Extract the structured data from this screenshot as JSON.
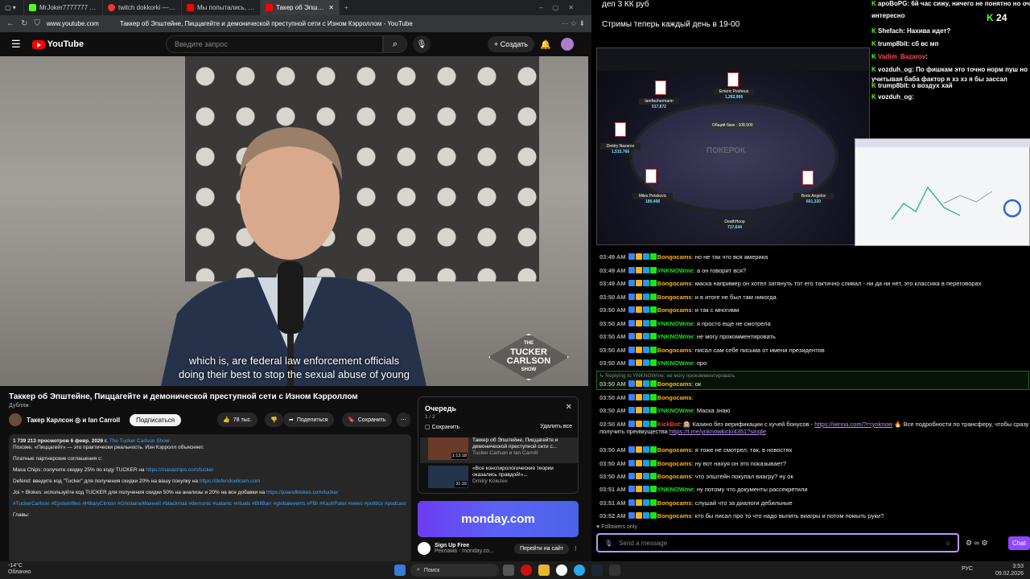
{
  "browser": {
    "tabs": [
      {
        "title": "MrJoker7777777 Clips - W",
        "color": "#53fc18"
      },
      {
        "title": "twitch dokkorki — Яндекс",
        "color": "#ff3333"
      },
      {
        "title": "Мы попытались, но что-т",
        "color": "#ff0000"
      },
      {
        "title": "Такер об Эпштейне",
        "color": "#ff0000"
      }
    ],
    "url": "www.youtube.com",
    "page_title": "Таккер об Эпштейне, Пиццагейте и демонической преступной сети с Изном Кэрроллом - YouTube"
  },
  "youtube": {
    "logo": "YouTube",
    "search_placeholder": "Введите запрос",
    "create": "+ Создать",
    "subtitle_line1": "which is, are federal law enforcement officials",
    "subtitle_line2": "doing their best to stop the sexual abuse of young",
    "badge": [
      "THE",
      "TUCKER",
      "CARLSON",
      "SHOW"
    ],
    "video_title": "Таккер об Эпштейне, Пиццагейте и демонической преступной сети с Изном Кэрроллом",
    "dub": "Дубляж",
    "channel": "Такер Карлсон ◎ и Ian Carroll",
    "subscribe": "Подписаться",
    "likes": "78 тыс.",
    "share": "Поделиться",
    "save": "Сохранить",
    "desc": {
      "meta": "1 739 213 просмотров  6 февр. 2026 г.",
      "meta_link": "The Tucker Carlson Show",
      "line1": "Похоже, «Пиццагейт» — это практически реальность. Иэн Кэрролл объясняет.",
      "partners": "Платные партнерские соглашения с:",
      "masa": "Masa Chips: получите скидку 25% по коду TUCKER на",
      "masa_link": "https://masachips.com/tucker",
      "defend": "Defend: введите код \"Tucker\" для получения скидки 20% на вашу покупку на",
      "defend_link": "https://defendcellcam.com",
      "joi": "Joi + Blokes: используйте код TUCKER для получения скидки 50% на анализы и 20% на все добавки на",
      "joi_link": "https://joiandblokes.com/tucker",
      "tags": "#TuckerCarlson #Epsteinfiles #HillaryClinton #GhislaineMaxwell #blackmail #demonic #satanic #rituals #BillBarr #globalevents #FBI #KashPatel #news #politics #podcast",
      "chapters": "Главы:"
    },
    "queue": {
      "title": "Очередь",
      "count": "1 / 2",
      "save": "Сохранить",
      "delete_all": "Удалить все",
      "items": [
        {
          "title": "Таккер об Эпштейне, Пиццагейте и демонической преступной сети с...",
          "channel": "Tucker Carlson и Ian Carroll",
          "duration": "1:13:18"
        },
        {
          "title": "«Все конспирологические теории оказались правдой!»...",
          "channel": "Dmitry Kolezev",
          "duration": "31:16"
        }
      ]
    },
    "ad": {
      "brand": "monday.com",
      "title": "Sign Up Free",
      "sub": "Реклама · monday.co...",
      "cta": "Перейти на сайт"
    }
  },
  "stream": {
    "title1": "деп 3 КК руб",
    "title2": "Стримы теперь каждый день в 19-00",
    "counter": "24",
    "poker": {
      "logo": "ПОКЕРОК",
      "pot": "Общий банк : 108,500",
      "seats": [
        {
          "name": "Iamfischermann",
          "stack": "517,872"
        },
        {
          "name": "Emeric Pesheus",
          "stack": "1,282,906"
        },
        {
          "name": "Dmitry Nazarov",
          "stack": "1,515,766"
        },
        {
          "name": "Miles Petskovic",
          "stack": "189,408"
        },
        {
          "name": "Boris Angelov",
          "stack": "601,330"
        },
        {
          "name": "DeathHoop",
          "stack": "717,644"
        }
      ]
    }
  },
  "topchat": [
    {
      "user": "apoBoPG",
      "text": ": 6й час сижу, ничего не понятно но очень",
      "color": "#ffffff"
    },
    {
      "user": "",
      "text": "интересно",
      "color": "#ffffff"
    },
    {
      "user": "Shefach",
      "text": ": Нахива идет?",
      "color": "#ffffff"
    },
    {
      "user": "trump8bit",
      "text": ": сб вс мп",
      "color": "#ffffff"
    },
    {
      "user": "Vadim_Bazarov",
      "text": ":",
      "color": "#ff4d4d"
    },
    {
      "user": "vozduh_og",
      "text": ": По фишкам это точно норм пуш но",
      "color": "#ffffff"
    },
    {
      "user": "",
      "text": "учитывая баба фактор я хз хз я бы зассал",
      "color": "#ffffff"
    },
    {
      "user": "trump8bit",
      "text": ": о воздух хай",
      "color": "#ffffff"
    },
    {
      "user": "vozduh_og",
      "text": ":",
      "color": "#ffffff"
    }
  ],
  "chat": [
    {
      "time": "03:49 AM",
      "user": "Bongocams",
      "text": "но не так что вся америка",
      "color": "#ffb31a"
    },
    {
      "time": "03:49 AM",
      "user": "YNKNOWme",
      "text": "а он говорит вся?",
      "color": "#19e619"
    },
    {
      "time": "03:49 AM",
      "user": "Bongocams",
      "text": "маска например он хотел затянуть тот его тактично сливал - ни да ни нет, это классика в переговорах",
      "color": "#ffb31a"
    },
    {
      "time": "03:50 AM",
      "user": "Bongocams",
      "text": "и в итоге не был там никогда",
      "color": "#ffb31a"
    },
    {
      "time": "03:50 AM",
      "user": "Bongocams",
      "text": "и так с многими",
      "color": "#ffb31a"
    },
    {
      "time": "03:50 AM",
      "user": "YNKNOWme",
      "text": "я просто еще не смотрела",
      "color": "#19e619"
    },
    {
      "time": "03:50 AM",
      "user": "YNKNOWme",
      "text": "не могу прокомментировать",
      "color": "#19e619"
    },
    {
      "time": "03:50 AM",
      "user": "Bongocams",
      "text": "писал сам себе письма от имени президентов",
      "color": "#ffb31a"
    },
    {
      "time": "03:50 AM",
      "user": "YNKNOWme",
      "text": "про",
      "color": "#19e619"
    },
    {
      "time": "03:50 AM",
      "user": "Bongocams",
      "text": "ок",
      "color": "#ffb31a"
    },
    {
      "time": "03:50 AM",
      "user": "Bongocams",
      "text": "",
      "color": "#ffb31a"
    },
    {
      "time": "03:50 AM",
      "user": "YNKNOWme",
      "text": "Маска знаю",
      "color": "#19e619"
    },
    {
      "time": "03:50 AM",
      "user": "KickBot",
      "text": "🎰 Казино без верификации с кучей бонусов -",
      "color": "#ff3b3b"
    },
    {
      "time": "03:50 AM",
      "user": "Bongocams",
      "text": "я тоже не смотрел, так, в новостях",
      "color": "#ffb31a"
    },
    {
      "time": "03:50 AM",
      "user": "Bongocams",
      "text": "ну вот нахуя он это показывает?",
      "color": "#ffb31a"
    },
    {
      "time": "03:50 AM",
      "user": "Bongocams",
      "text": "что эпштейн покупал виагру? ну ок",
      "color": "#ffb31a"
    },
    {
      "time": "03:51 AM",
      "user": "YNKNOWme",
      "text": "ну потому что документы рассекретили",
      "color": "#19e619"
    },
    {
      "time": "03:51 AM",
      "user": "Bongocams",
      "text": "слушай что за диалоги дебильные",
      "color": "#ffb31a"
    },
    {
      "time": "03:52 AM",
      "user": "Bongocams",
      "text": "кто бы писал про то что надо выпить виагры и потом помыть руки?",
      "color": "#ffb31a"
    }
  ],
  "reply_line": "↳ Replying to YNKNOWme: не могу прокомментировать",
  "kick_link1": "https://winna.com/?r=ynknow",
  "kick_text2": "🔥 Все подробности по трансферу, чтобы сразу",
  "kick_text3": "получить преимущества",
  "kick_link2": "https://t.me/ynknowkick/4351?single",
  "followers_only": "♥ Followers only",
  "input_placeholder": "Send a message",
  "chat_button": "Chat",
  "taskbar": {
    "temp": "-14°C",
    "weather": "Облачно",
    "search": "Поиск",
    "lang": "РУС",
    "time": "3:53",
    "date": "09.02.2026"
  }
}
